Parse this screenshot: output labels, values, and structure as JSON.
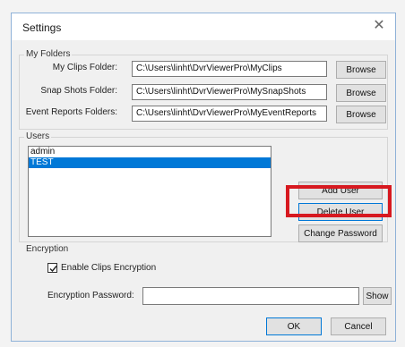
{
  "window": {
    "title": "Settings",
    "close_glyph": "✕"
  },
  "folders": {
    "group_label": "My Folders",
    "browse_label": "Browse",
    "rows": [
      {
        "label": "My Clips Folder:",
        "value": "C:\\Users\\linht\\DvrViewerPro\\MyClips"
      },
      {
        "label": "Snap Shots Folder:",
        "value": "C:\\Users\\linht\\DvrViewerPro\\MySnapShots"
      },
      {
        "label": "Event Reports Folders:",
        "value": "C:\\Users\\linht\\DvrViewerPro\\MyEventReports"
      }
    ]
  },
  "users": {
    "group_label": "Users",
    "items": [
      "admin",
      "TEST"
    ],
    "selected_index": 1,
    "add_user_label": "Add User",
    "delete_user_label": "Delete User",
    "change_password_label": "Change Password"
  },
  "encryption": {
    "group_label": "Encryption",
    "enable_label": "Enable Clips Encryption",
    "enabled": true,
    "password_label": "Encryption Password:",
    "password_value": "",
    "show_label": "Show"
  },
  "footer": {
    "ok_label": "OK",
    "cancel_label": "Cancel"
  },
  "colors": {
    "highlight": "#d71920",
    "selection": "#0078d7",
    "focus_border": "#0078d7"
  }
}
